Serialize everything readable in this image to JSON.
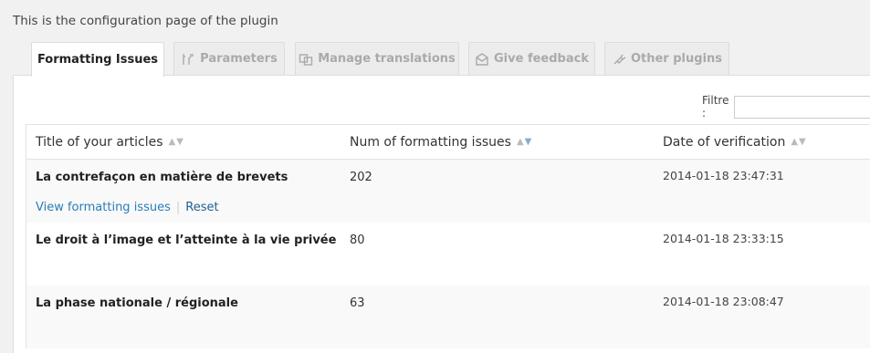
{
  "intro": "This is the configuration page of the plugin",
  "tabs": [
    {
      "label": "Formatting Issues",
      "icon": "",
      "active": true
    },
    {
      "label": "Parameters",
      "icon": "tools-icon",
      "active": false
    },
    {
      "label": "Manage translations",
      "icon": "translations-icon",
      "active": false
    },
    {
      "label": "Give feedback",
      "icon": "feedback-icon",
      "active": false
    },
    {
      "label": "Other plugins",
      "icon": "plugin-icon",
      "active": false
    }
  ],
  "filter": {
    "label": "Filtre :",
    "value": "",
    "placeholder": ""
  },
  "table": {
    "columns": [
      {
        "label": "Title of your articles",
        "sort": "none"
      },
      {
        "label": "Num of formatting issues",
        "sort": "desc"
      },
      {
        "label": "Date of verification",
        "sort": "none"
      }
    ],
    "rows": [
      {
        "title": "La contrefaçon en matière de brevets",
        "num": "202",
        "date": "2014-01-18 23:47:31",
        "actions": {
          "view": "View formatting issues",
          "reset": "Reset"
        }
      },
      {
        "title": "Le droit à l’image et l’atteinte à la vie privée",
        "num": "80",
        "date": "2014-01-18 23:33:15"
      },
      {
        "title": "La phase nationale / régionale",
        "num": "63",
        "date": "2014-01-18 23:08:47"
      }
    ]
  },
  "colors": {
    "link": "#2a7db8",
    "active_sort": "#8fa6d6"
  }
}
